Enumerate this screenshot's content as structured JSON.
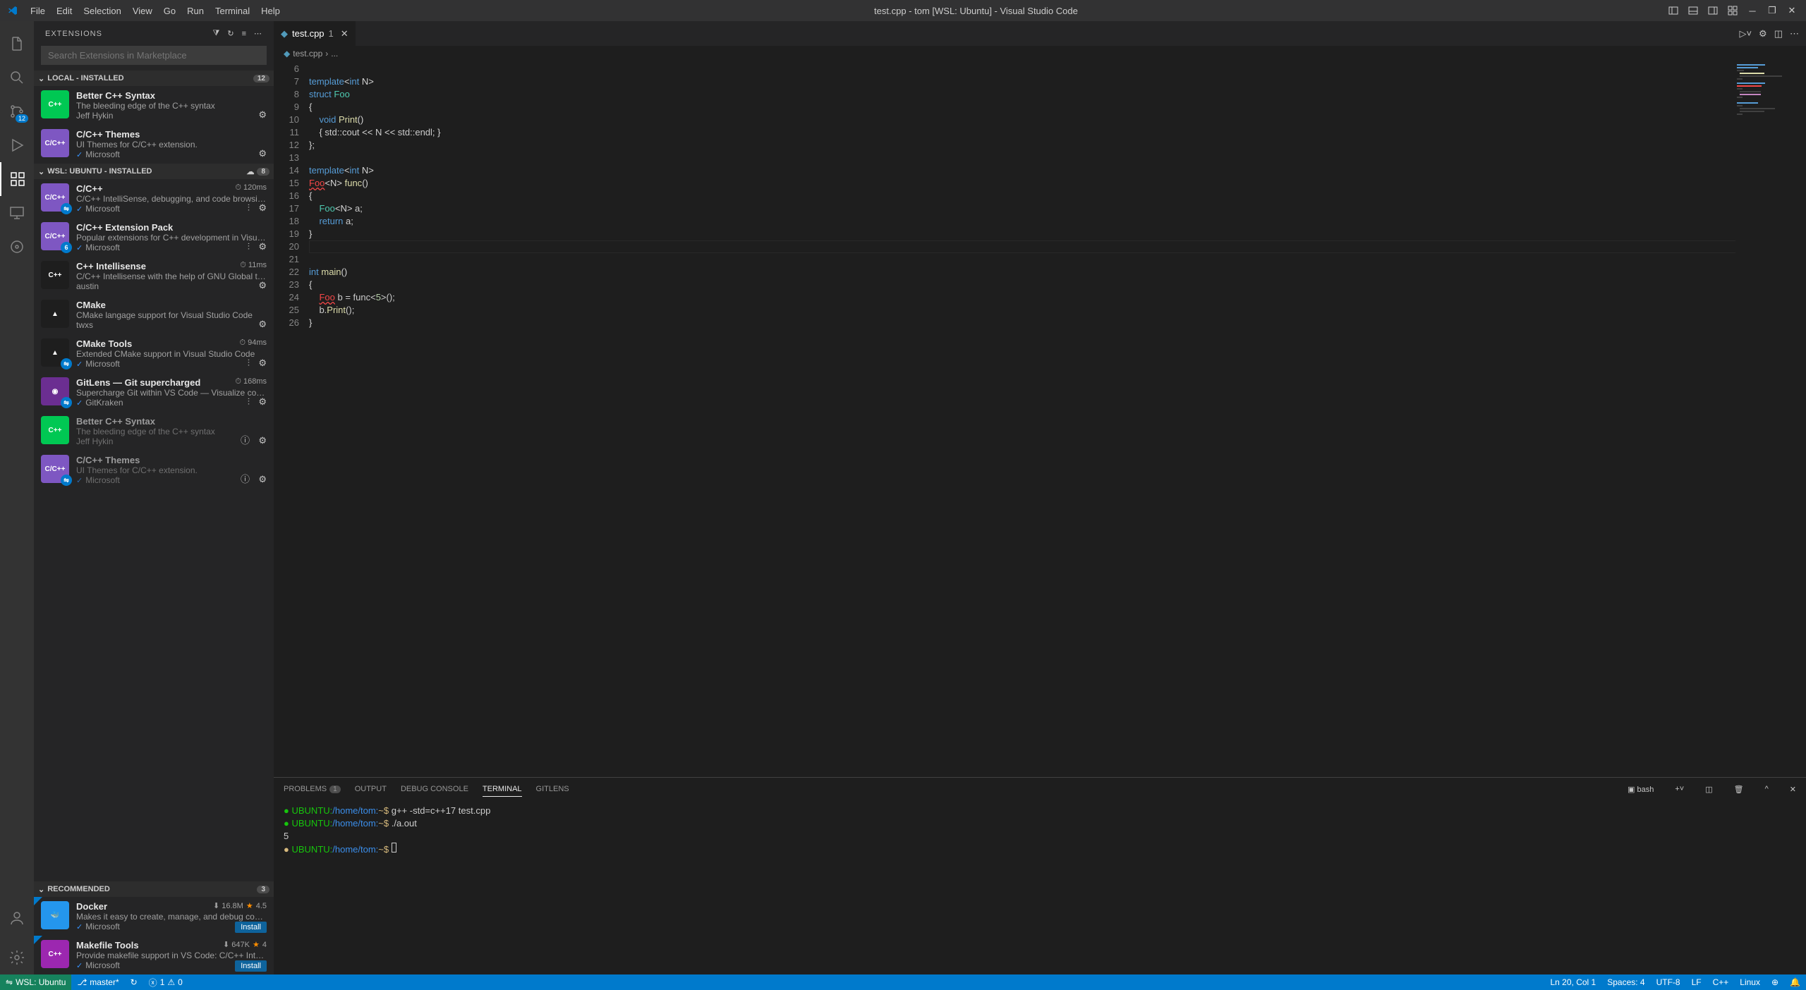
{
  "titlebar": {
    "title": "test.cpp - tom [WSL: Ubuntu] - Visual Studio Code",
    "menu": [
      "File",
      "Edit",
      "Selection",
      "View",
      "Go",
      "Run",
      "Terminal",
      "Help"
    ]
  },
  "sidebar": {
    "title": "EXTENSIONS",
    "search_placeholder": "Search Extensions in Marketplace",
    "sections": {
      "local": {
        "label": "LOCAL - INSTALLED",
        "count": "12"
      },
      "wsl": {
        "label": "WSL: UBUNTU - INSTALLED",
        "count": "8"
      },
      "recommended": {
        "label": "RECOMMENDED",
        "count": "3"
      }
    },
    "local_items": [
      {
        "name": "Better C++ Syntax",
        "desc": "The bleeding edge of the C++ syntax",
        "pub": "Jeff Hykin",
        "verified": false,
        "icon_bg": "#00c853",
        "icon_text": "C++"
      },
      {
        "name": "C/C++ Themes",
        "desc": "UI Themes for C/C++ extension.",
        "pub": "Microsoft",
        "verified": true,
        "icon_bg": "#7e57c2",
        "icon_text": "C/C++"
      }
    ],
    "wsl_items": [
      {
        "name": "C/C++",
        "desc": "C/C++ IntelliSense, debugging, and code browsing.",
        "pub": "Microsoft",
        "verified": true,
        "icon_bg": "#7e57c2",
        "icon_text": "C/C++",
        "meta": "120ms",
        "remote": true
      },
      {
        "name": "C/C++ Extension Pack",
        "desc": "Popular extensions for C++ development in Visual Studio ...",
        "pub": "Microsoft",
        "verified": true,
        "icon_bg": "#7e57c2",
        "icon_text": "C/C++",
        "badge": "6",
        "remote": true
      },
      {
        "name": "C++ Intellisense",
        "desc": "C/C++ Intellisense with the help of GNU Global tags",
        "pub": "austin",
        "verified": false,
        "icon_bg": "#1e1e1e",
        "icon_text": "C++",
        "meta": "11ms"
      },
      {
        "name": "CMake",
        "desc": "CMake langage support for Visual Studio Code",
        "pub": "twxs",
        "verified": false,
        "icon_bg": "#1e1e1e",
        "icon_text": "▲"
      },
      {
        "name": "CMake Tools",
        "desc": "Extended CMake support in Visual Studio Code",
        "pub": "Microsoft",
        "verified": true,
        "icon_bg": "#1e1e1e",
        "icon_text": "▲",
        "meta": "94ms",
        "remote": true
      },
      {
        "name": "GitLens — Git supercharged",
        "desc": "Supercharge Git within VS Code — Visualize code authors...",
        "pub": "GitKraken",
        "verified": true,
        "icon_bg": "#6b2e91",
        "icon_text": "◉",
        "meta": "168ms",
        "remote": true
      },
      {
        "name": "Better C++ Syntax",
        "desc": "The bleeding edge of the C++ syntax",
        "pub": "Jeff Hykin",
        "verified": false,
        "icon_bg": "#00c853",
        "icon_text": "C++",
        "dimmed": true,
        "info": true
      },
      {
        "name": "C/C++ Themes",
        "desc": "UI Themes for C/C++ extension.",
        "pub": "Microsoft",
        "verified": true,
        "icon_bg": "#7e57c2",
        "icon_text": "C/C++",
        "dimmed": true,
        "info": true,
        "remote": true
      }
    ],
    "rec_items": [
      {
        "name": "Docker",
        "desc": "Makes it easy to create, manage, and debug containerized ...",
        "pub": "Microsoft",
        "verified": true,
        "icon_bg": "#2496ed",
        "icon_text": "🐳",
        "installs": "16.8M",
        "rating": "4.5",
        "install": true
      },
      {
        "name": "Makefile Tools",
        "desc": "Provide makefile support in VS Code: C/C++ IntelliSense, b...",
        "pub": "Microsoft",
        "verified": true,
        "icon_bg": "#9c27b0",
        "icon_text": "C++",
        "installs": "647K",
        "rating": "4",
        "install": true
      }
    ]
  },
  "activitybar": {
    "scm_badge": "12"
  },
  "editor": {
    "tab_name": "test.cpp",
    "tab_mod": "1",
    "breadcrumb": [
      "test.cpp",
      "..."
    ],
    "lines_start": 6,
    "lines_end": 26
  },
  "panel": {
    "tabs": {
      "problems": "PROBLEMS",
      "problems_count": "1",
      "output": "OUTPUT",
      "debug": "DEBUG CONSOLE",
      "terminal": "TERMINAL",
      "gitlens": "GITLENS"
    },
    "term_shell": "bash",
    "terminal_lines": [
      {
        "dot": "green",
        "prompt": "UBUNTU:",
        "path": "/home/tom:",
        "sym": "~$ ",
        "cmd": "g++ -std=c++17 test.cpp"
      },
      {
        "dot": "green",
        "prompt": "UBUNTU:",
        "path": "/home/tom:",
        "sym": "~$ ",
        "cmd": "./a.out"
      },
      {
        "output": "5"
      },
      {
        "dot": "yellow",
        "prompt": "UBUNTU:",
        "path": "/home/tom:",
        "sym": "~$ ",
        "cursor": true
      }
    ]
  },
  "statusbar": {
    "remote": "WSL: Ubuntu",
    "branch": "master*",
    "errors": "1",
    "warnings": "0",
    "position": "Ln 20, Col 1",
    "spaces": "Spaces: 4",
    "encoding": "UTF-8",
    "eol": "LF",
    "lang": "C++",
    "os": "Linux"
  },
  "install_label": "Install"
}
